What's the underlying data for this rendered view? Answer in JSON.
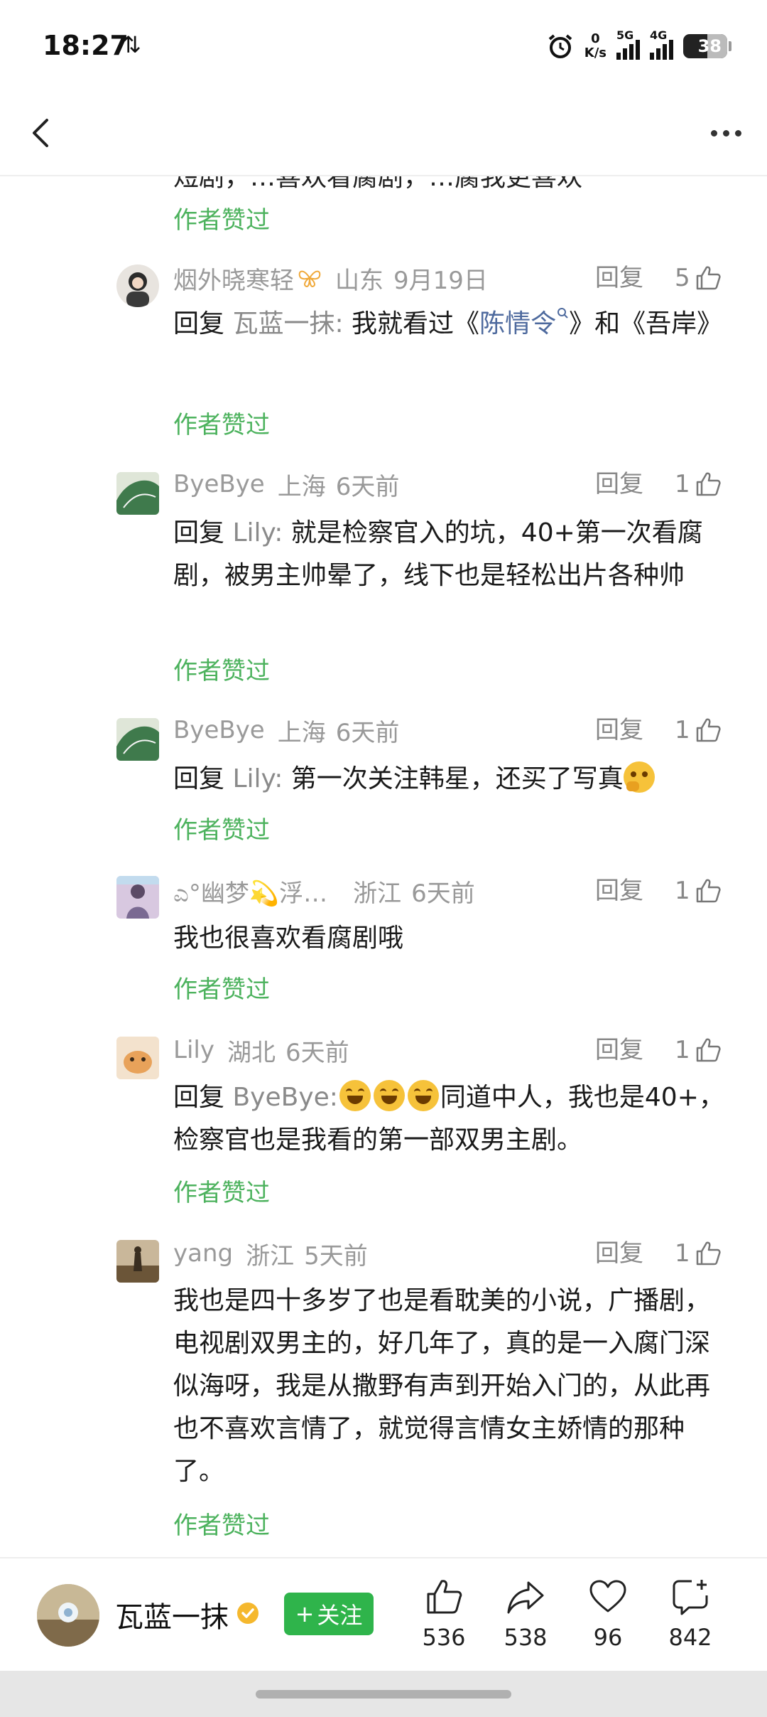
{
  "status_bar": {
    "time": "18:27",
    "transfer_icon": "⇅",
    "net_speed_value": "0",
    "net_speed_unit": "K/s",
    "sig1_label": "5G",
    "sig2_label": "4G",
    "battery": "38"
  },
  "nav": {
    "back_icon": "chevron-left-icon",
    "more_icon": "more-dots-icon"
  },
  "clipped_comment": {
    "text": "短剧，…喜欢看腐剧，…腐我更喜欢",
    "author_liked": "作者赞过"
  },
  "comments": [
    {
      "name": "烟外晓寒轻",
      "loc": "山东",
      "date": "9月19日",
      "reply": "回复",
      "likes": "5",
      "prefix": "回复",
      "target": "瓦蓝一抹:",
      "text1": " 我就看过《",
      "link": "陈情令",
      "text2": "》和《吾岸》",
      "author_liked": "作者赞过"
    },
    {
      "name": "ByeBye",
      "loc": "上海",
      "date": "6天前",
      "reply": "回复",
      "likes": "1",
      "prefix": "回复",
      "target": "Lily:",
      "text": " 就是检察官入的坑，40+第一次看腐剧，被男主帅晕了，线下也是轻松出片各种帅",
      "author_liked": "作者赞过"
    },
    {
      "name": "ByeBye",
      "loc": "上海",
      "date": "6天前",
      "reply": "回复",
      "likes": "1",
      "prefix": "回复",
      "target": "Lily:",
      "text": " 第一次关注韩星，还买了写真",
      "author_liked": "作者赞过"
    },
    {
      "name": "ಎ°幽梦💫浮…",
      "loc": "浙江",
      "date": "6天前",
      "reply": "回复",
      "likes": "1",
      "text": "我也很喜欢看腐剧哦",
      "author_liked": "作者赞过"
    },
    {
      "name": "Lily",
      "loc": "湖北",
      "date": "6天前",
      "reply": "回复",
      "likes": "1",
      "prefix": "回复",
      "target": "ByeBye:",
      "text": "同道中人，我也是40+，检察官也是我看的第一部双男主剧。",
      "author_liked": "作者赞过"
    },
    {
      "name": "yang",
      "loc": "浙江",
      "date": "5天前",
      "reply": "回复",
      "likes": "1",
      "text": "我也是四十多岁了也是看耽美的小说，广播剧，电视剧双男主的，好几年了，真的是一入腐门深似海呀，我是从撒野有声到开始入门的，从此再也不喜欢言情了，就觉得言情女主娇情的那种了。",
      "author_liked": "作者赞过"
    }
  ],
  "bottom_bar": {
    "author_name": "瓦蓝一抹",
    "follow_label": "关注",
    "follow_plus": "+",
    "like_count": "536",
    "share_count": "538",
    "favorite_count": "96",
    "comment_count": "842"
  },
  "colors": {
    "author_liked": "#4cb25d",
    "follow_button": "#2fb44b",
    "link": "#4e6a9e"
  }
}
